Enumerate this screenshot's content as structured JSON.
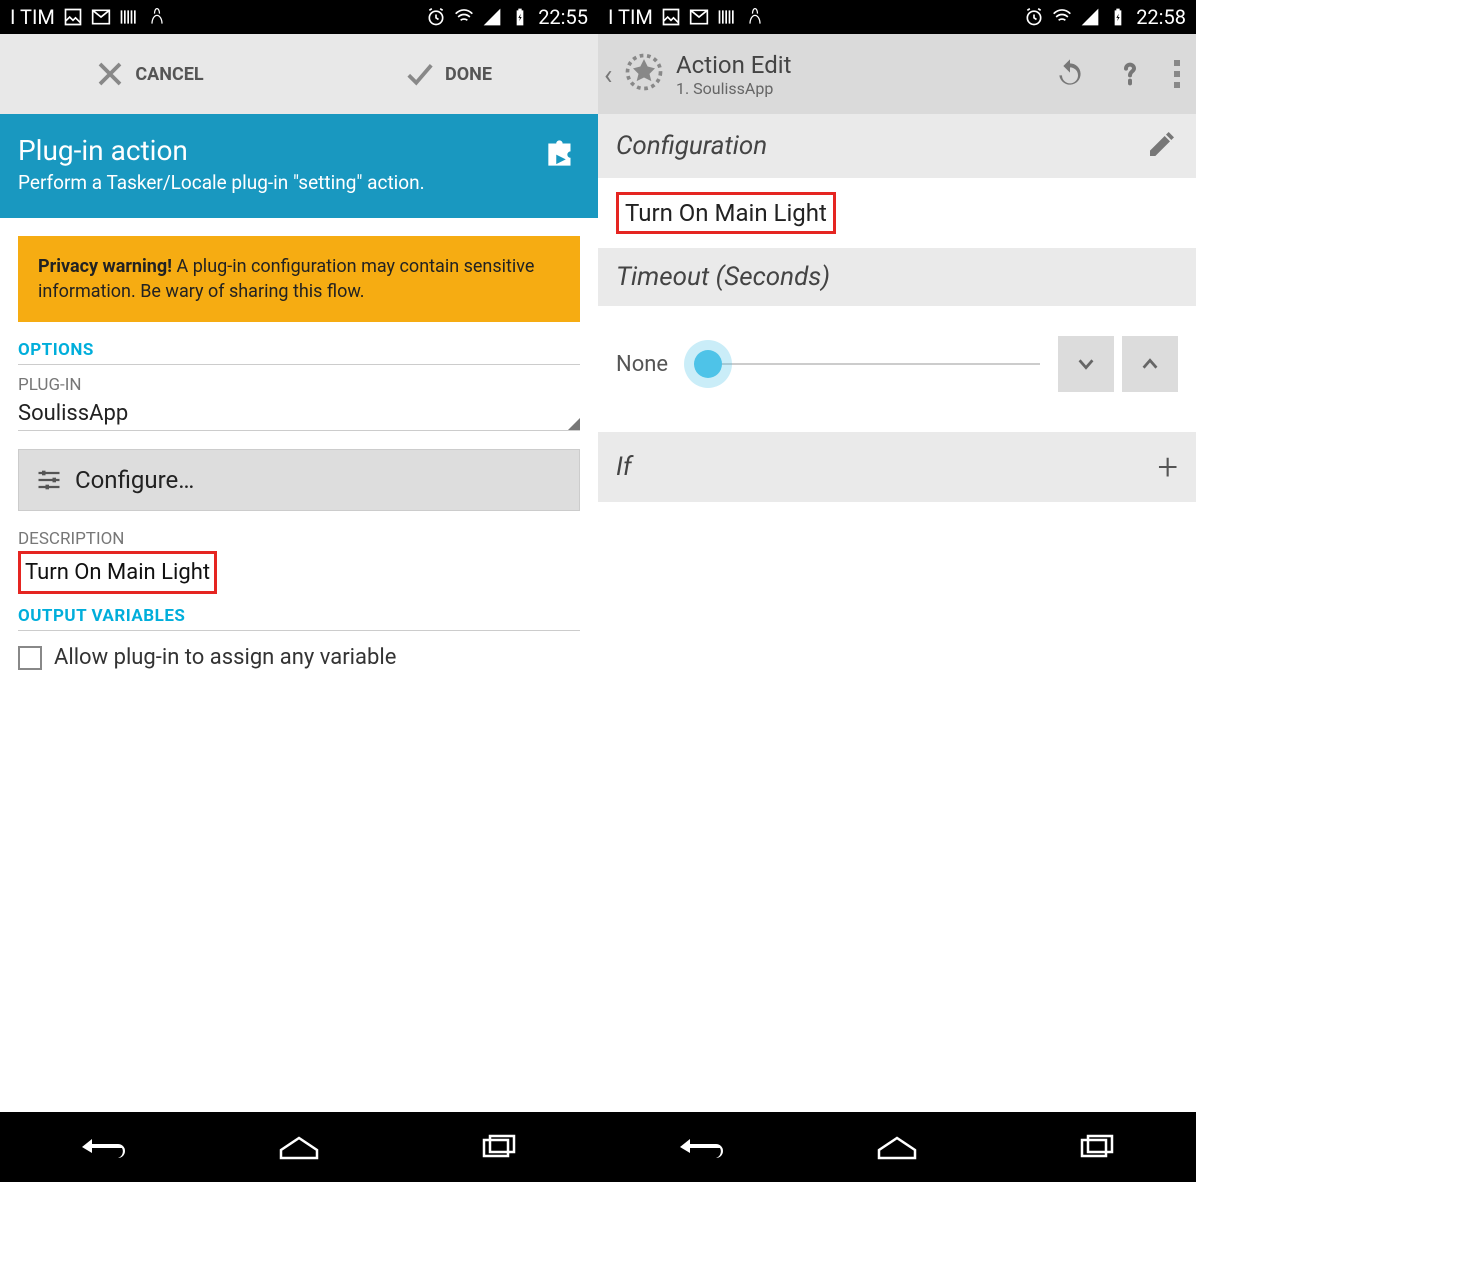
{
  "left": {
    "status": {
      "carrier": "I TIM",
      "time": "22:55"
    },
    "topbar": {
      "cancel": "CANCEL",
      "done": "DONE"
    },
    "header": {
      "title": "Plug-in action",
      "subtitle": "Perform a Tasker/Locale plug-in \"setting\" action."
    },
    "warning": {
      "bold": "Privacy warning!",
      "text": " A plug-in configuration may contain sensitive information. Be wary of sharing this flow."
    },
    "sections": {
      "options": "OPTIONS",
      "plugin_label": "PLUG-IN",
      "plugin_value": "SoulissApp",
      "configure": "Configure…",
      "description_label": "DESCRIPTION",
      "description_value": "Turn On Main Light",
      "output_vars": "OUTPUT VARIABLES",
      "checkbox": "Allow plug-in to assign any variable"
    }
  },
  "right": {
    "status": {
      "carrier": "I TIM",
      "time": "22:58"
    },
    "header": {
      "title": "Action Edit",
      "subtitle": "1. SoulissApp"
    },
    "config": {
      "label": "Configuration",
      "value": "Turn On Main Light"
    },
    "timeout": {
      "label": "Timeout (Seconds)",
      "value": "None"
    },
    "if": {
      "label": "If"
    }
  }
}
